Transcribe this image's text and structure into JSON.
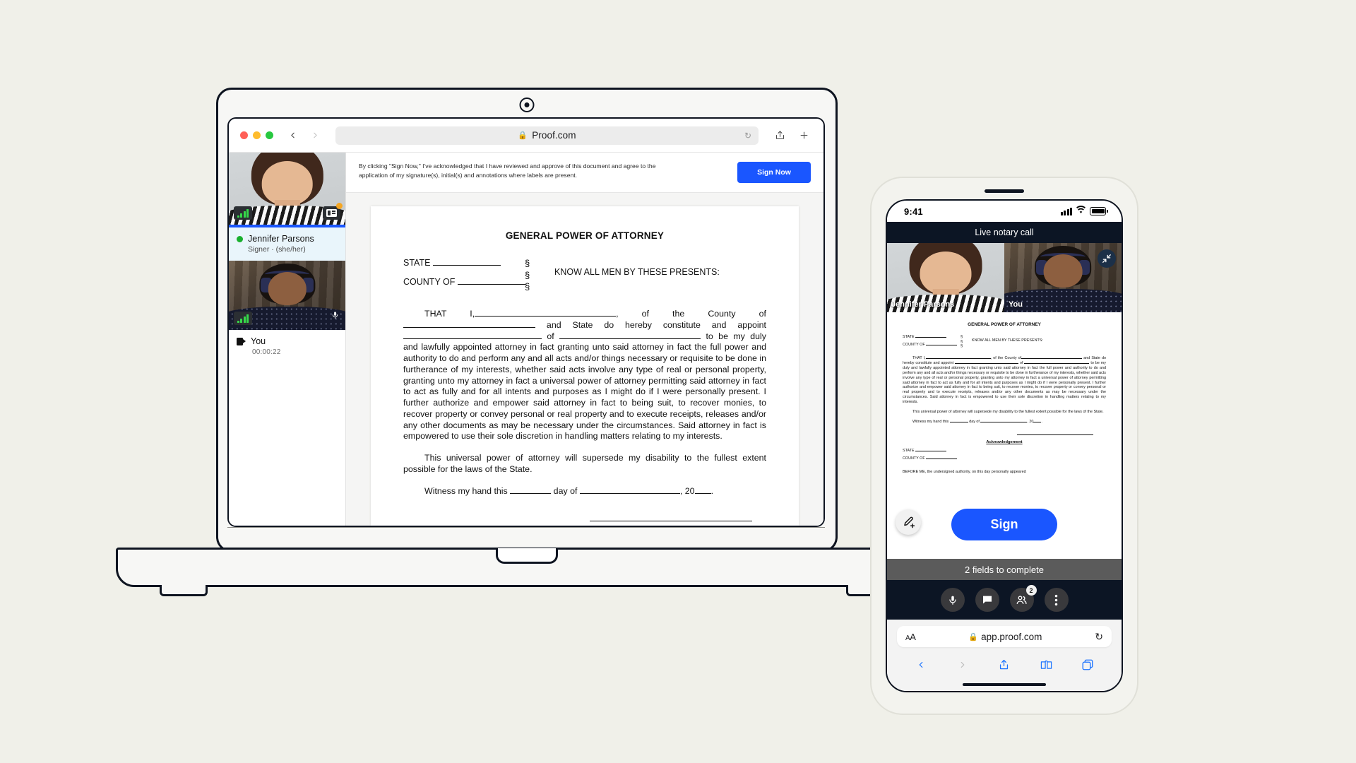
{
  "browser": {
    "url": "Proof.com",
    "lock_icon": "lock-icon",
    "back_icon": "chevron-left-icon",
    "forward_icon": "chevron-right-icon",
    "reload_icon": "reload-icon",
    "share_icon": "share-icon",
    "new_tab_icon": "plus-icon"
  },
  "sidebar": {
    "participants": [
      {
        "name": "Jennifer Parsons",
        "role": "Signer · (she/her)",
        "status_icon": "green-status-dot",
        "active": true
      },
      {
        "name": "You",
        "timer": "00:00:22",
        "icon": "video-camera-icon",
        "active": false
      }
    ]
  },
  "consent": {
    "text": "By clicking \"Sign Now,\" I've acknowledged that I have reviewed and approve of this document and agree to the application of my signature(s), initial(s) and annotations where labels are present.",
    "sign_now_label": "Sign Now",
    "sign_now_color": "#1a56ff"
  },
  "document": {
    "title": "GENERAL POWER OF ATTORNEY",
    "state_label": "STATE",
    "county_label": "COUNTY OF",
    "section_marks": "§",
    "know_all": "KNOW ALL MEN BY THESE PRESENTS:",
    "p1_a": "THAT I,",
    "p1_b": ", of the County of",
    "p1_c": "and State do hereby constitute and appoint",
    "p1_d": "of",
    "p1_e": "to be my duly and lawfully appointed attorney in fact granting unto said attorney in fact the full power and authority to do and perform any and all acts and/or things necessary or requisite to be done in furtherance of my interests, whether said acts involve any type of real or personal property, granting unto my attorney in fact a universal power of attorney permitting said attorney in fact to act as fully and for all intents and purposes as I might do if I were personally present.  I further authorize and empower said attorney in fact to being suit, to recover monies, to recover property or convey personal or real property and to execute receipts, releases and/or any other documents as may be necessary under the circumstances.  Said attorney in fact is empowered to use their sole discretion in handling matters relating to my interests.",
    "p2": "This universal power of attorney will supersede my disability to the fullest extent possible for the laws of the State.",
    "p3_a": "Witness my hand this",
    "p3_b": "day of",
    "p3_c": ", 20",
    "p3_d": ".",
    "acknowledgement": "Acknowledgement",
    "ack_before_me": "BEFORE ME, the undersigned authority, on this day personally appeared"
  },
  "phone": {
    "status": {
      "time": "9:41",
      "cell_icon": "cellular-signal-icon",
      "wifi_icon": "wifi-icon",
      "battery_icon": "battery-full-icon"
    },
    "call_header": "Live notary call",
    "minimize_icon": "minimize-fullscreen-icon",
    "tiles": [
      {
        "label": "Jennifer Parsons"
      },
      {
        "label": "You"
      }
    ],
    "sign_label": "Sign",
    "sign_color": "#1a56ff",
    "fields_banner": "2 fields to complete",
    "fab_icon": "pencil-plus-icon",
    "controls": [
      {
        "icon": "microphone-icon",
        "name": "mic-button",
        "badge": null
      },
      {
        "icon": "chat-bubble-icon",
        "name": "chat-button",
        "badge": null
      },
      {
        "icon": "participants-icon",
        "name": "participants-button",
        "badge": "2"
      },
      {
        "icon": "more-vertical-icon",
        "name": "more-button",
        "badge": null
      }
    ],
    "safari": {
      "text_size_label": "AA",
      "url": "app.proof.com",
      "lock_icon": "lock-icon",
      "reload_icon": "reload-icon",
      "back_icon": "chevron-left-icon",
      "forward_icon": "chevron-right-icon",
      "share_icon": "share-icon",
      "bookmarks_icon": "book-icon",
      "tabs_icon": "tabs-icon"
    }
  }
}
